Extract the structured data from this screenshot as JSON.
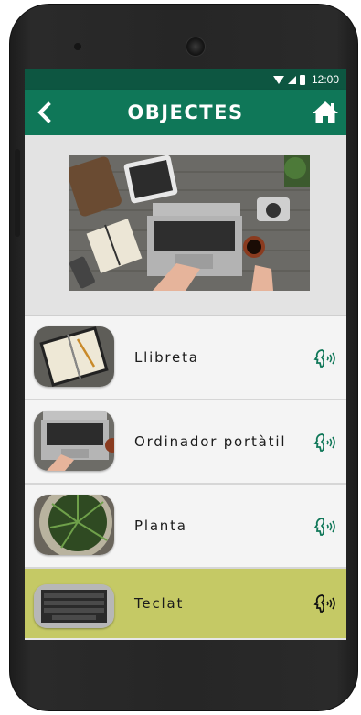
{
  "statusbar": {
    "time": "12:00"
  },
  "appbar": {
    "title": "OBJECTES"
  },
  "items": [
    {
      "label": "Llibreta",
      "thumb": "notebook-thumbnail"
    },
    {
      "label": "Ordinador portàtil",
      "thumb": "laptop-thumbnail"
    },
    {
      "label": "Planta",
      "thumb": "plant-thumbnail"
    },
    {
      "label": "Teclat",
      "thumb": "keyboard-thumbnail"
    }
  ],
  "colors": {
    "statusbar": "#0d5641",
    "appbar": "#0f7758",
    "selected_row": "#c5c965",
    "audio_icon": "#0f7758"
  },
  "icons": [
    "back-arrow-icon",
    "home-icon",
    "speaking-head-icon",
    "wifi-icon",
    "signal-icon",
    "battery-icon"
  ]
}
